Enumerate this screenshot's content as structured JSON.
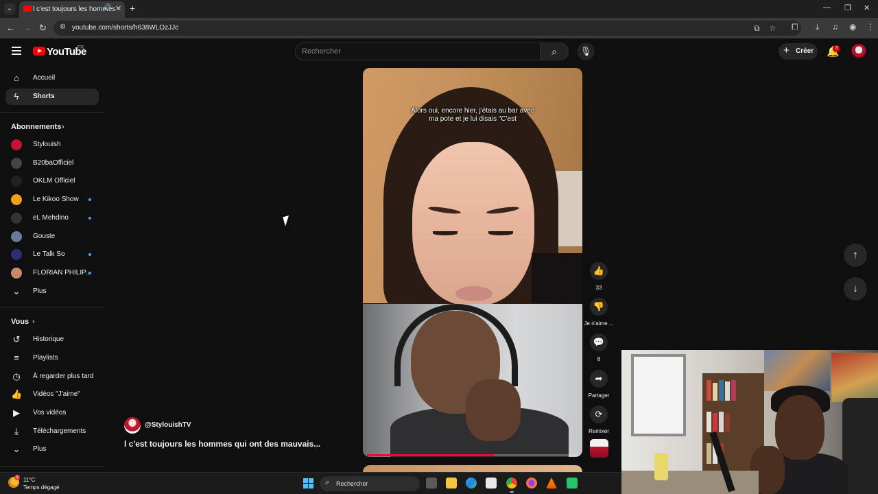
{
  "browser": {
    "tab_title": "l c'est toujours les hommes qui ont des mauvais...",
    "url": "youtube.com/shorts/h638WLOzJJc",
    "window_controls": [
      "—",
      "❐",
      "✕"
    ]
  },
  "header": {
    "logo_text": "YouTube",
    "region": "FR",
    "search_placeholder": "Rechercher",
    "create_label": "Créer",
    "notification_count": "3"
  },
  "sidebar": {
    "main": [
      {
        "label": "Accueil",
        "icon": "home-icon"
      },
      {
        "label": "Shorts",
        "icon": "shorts-icon"
      }
    ],
    "subscriptions_title": "Abonnements",
    "subscriptions": [
      {
        "label": "Stylouish",
        "new": false,
        "color": "#c21531"
      },
      {
        "label": "B20baOfficiel",
        "new": false,
        "color": "#444444"
      },
      {
        "label": "OKLM Officiel",
        "new": false,
        "color": "#222222"
      },
      {
        "label": "Le Kikoo Show",
        "new": true,
        "color": "#f0a019"
      },
      {
        "label": "eL Mehdino",
        "new": true,
        "color": "#333333"
      },
      {
        "label": "Gouste",
        "new": false,
        "color": "#6b7a99"
      },
      {
        "label": "Le Talk So",
        "new": true,
        "color": "#2b2f7a"
      },
      {
        "label": "FLORIAN PHILIP...",
        "new": true,
        "color": "#c98a6a"
      }
    ],
    "subscriptions_more": "Plus",
    "you_title": "Vous",
    "you_items": [
      {
        "label": "Historique",
        "icon": "history-icon"
      },
      {
        "label": "Playlists",
        "icon": "playlists-icon"
      },
      {
        "label": "À regarder plus tard",
        "icon": "watch-later-icon"
      },
      {
        "label": "Vidéos \"J'aime\"",
        "icon": "like-icon"
      },
      {
        "label": "Vos vidéos",
        "icon": "your-videos-icon"
      },
      {
        "label": "Téléchargements",
        "icon": "download-icon"
      }
    ],
    "you_more": "Plus"
  },
  "short": {
    "caption": "Alors oui, encore hier, j'étais au bar avec ma pote et je lui disais \"C'est",
    "channel": "@StylouishTV",
    "title": "l c'est toujours les hommes qui ont des mauvais...",
    "progress": 0.6
  },
  "actions": {
    "like_count": "33",
    "dislike_label": "Je n'aime ...",
    "comment_count": "8",
    "share_label": "Partager",
    "remix_label": "Remixer"
  },
  "taskbar": {
    "temperature": "11°C",
    "weather": "Temps dégagé",
    "weather_badge": "1",
    "search_label": "Rechercher"
  },
  "colors": {
    "youtube_red": "#ff0000",
    "progress_red": "#ff0033",
    "background": "#0f0f0f"
  }
}
